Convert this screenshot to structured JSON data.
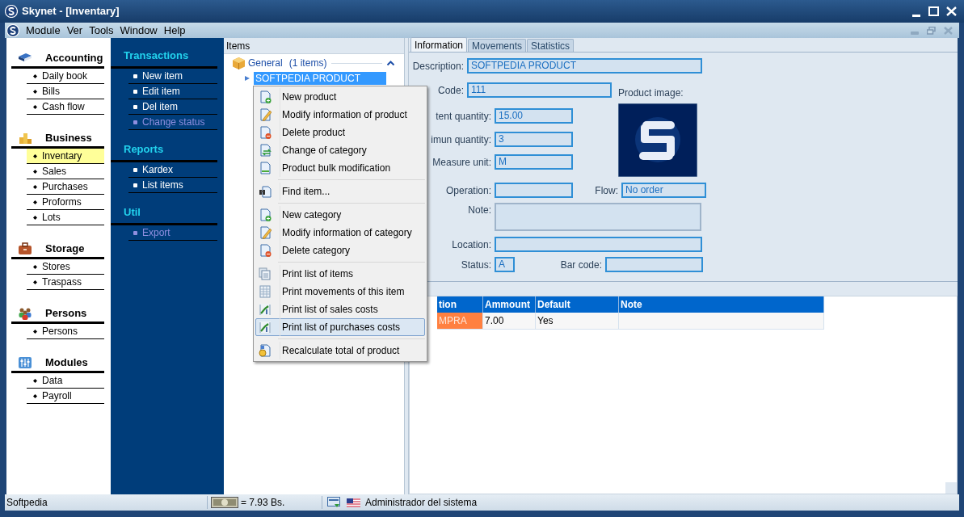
{
  "window": {
    "title": "Skynet - [Inventary]"
  },
  "menu_bar": [
    "Module",
    "Ver",
    "Tools",
    "Window",
    "Help"
  ],
  "sidebar": {
    "groups": [
      {
        "title": "Accounting",
        "items": [
          {
            "label": "Daily book",
            "selected": false
          },
          {
            "label": "Bills",
            "selected": false
          },
          {
            "label": "Cash flow",
            "selected": false
          }
        ]
      },
      {
        "title": "Business",
        "items": [
          {
            "label": "Inventary",
            "selected": true
          },
          {
            "label": "Sales",
            "selected": false
          },
          {
            "label": "Purchases",
            "selected": false
          },
          {
            "label": "Proforms",
            "selected": false
          },
          {
            "label": "Lots",
            "selected": false
          }
        ]
      },
      {
        "title": "Storage",
        "items": [
          {
            "label": "Stores",
            "selected": false
          },
          {
            "label": "Traspass",
            "selected": false
          }
        ]
      },
      {
        "title": "Persons",
        "items": [
          {
            "label": "Persons",
            "selected": false
          }
        ]
      },
      {
        "title": "Modules",
        "items": [
          {
            "label": "Data",
            "selected": false
          },
          {
            "label": "Payroll",
            "selected": false
          }
        ]
      }
    ]
  },
  "actions_panel": {
    "sections": [
      {
        "title": "Transactions",
        "items": [
          {
            "label": "New item",
            "disabled": false
          },
          {
            "label": "Edit item",
            "disabled": false
          },
          {
            "label": "Del item",
            "disabled": false
          },
          {
            "label": "Change status",
            "disabled": true
          }
        ]
      },
      {
        "title": "Reports",
        "items": [
          {
            "label": "Kardex",
            "disabled": false
          },
          {
            "label": "List items",
            "disabled": false
          }
        ]
      },
      {
        "title": "Util",
        "items": [
          {
            "label": "Export",
            "disabled": true
          }
        ]
      }
    ]
  },
  "items_panel": {
    "header": "Items",
    "category": {
      "label": "General",
      "count": "(1 items)",
      "expanded": true,
      "children": [
        {
          "label": "SOFTPEDIA PRODUCT",
          "selected": true
        }
      ]
    }
  },
  "context_menu": {
    "groups": [
      [
        {
          "label": "New product",
          "selected": false
        },
        {
          "label": "Modify information of product",
          "selected": false
        },
        {
          "label": "Delete product",
          "selected": false
        },
        {
          "label": "Change of category",
          "selected": false
        },
        {
          "label": "Product bulk modification",
          "selected": false
        }
      ],
      [
        {
          "label": "Find item...",
          "selected": false
        }
      ],
      [
        {
          "label": "New category",
          "selected": false
        },
        {
          "label": "Modify information of category",
          "selected": false
        },
        {
          "label": "Delete category",
          "selected": false
        }
      ],
      [
        {
          "label": "Print list of items",
          "selected": false
        },
        {
          "label": "Print movements of this item",
          "selected": false
        },
        {
          "label": "Print list of sales costs",
          "selected": false
        },
        {
          "label": "Print list of purchases costs",
          "selected": true
        }
      ],
      [
        {
          "label": "Recalculate total of product",
          "selected": false
        }
      ]
    ]
  },
  "tabs": [
    {
      "label": "Information",
      "selected": true
    },
    {
      "label": "Movements",
      "selected": false
    },
    {
      "label": "Statistics",
      "selected": false
    }
  ],
  "form": {
    "description": {
      "label": "Description:",
      "value": "SOFTPEDIA PRODUCT"
    },
    "code": {
      "label": "Code:",
      "value": "111"
    },
    "product_image": {
      "label": "Product image:",
      "kind": "picture"
    },
    "existent_quantity": {
      "label": "tent quantity:",
      "value": "15.00"
    },
    "minimun_quantity": {
      "label": "imun quantity:",
      "value": "3"
    },
    "measure_unit": {
      "label": "Measure unit:",
      "value": "M"
    },
    "operation": {
      "label": "Operation:"
    },
    "flow": {
      "label": "Flow:",
      "value": "No order"
    },
    "note": {
      "label": "Note:"
    },
    "location": {
      "label": "Location:"
    },
    "status": {
      "label": "Status:",
      "value": "A"
    },
    "bar_code": {
      "label": "Bar code:"
    }
  },
  "table": {
    "columns": [
      "tion",
      "Ammount",
      "Default",
      "Note"
    ],
    "rows": [
      {
        "cells": [
          "MPRA",
          "7.00",
          "Yes"
        ],
        "selected": true
      }
    ]
  },
  "status_bar": {
    "left": "Softpedia",
    "amount": "= 7.93 Bs.",
    "user": "Administrador del sistema"
  }
}
